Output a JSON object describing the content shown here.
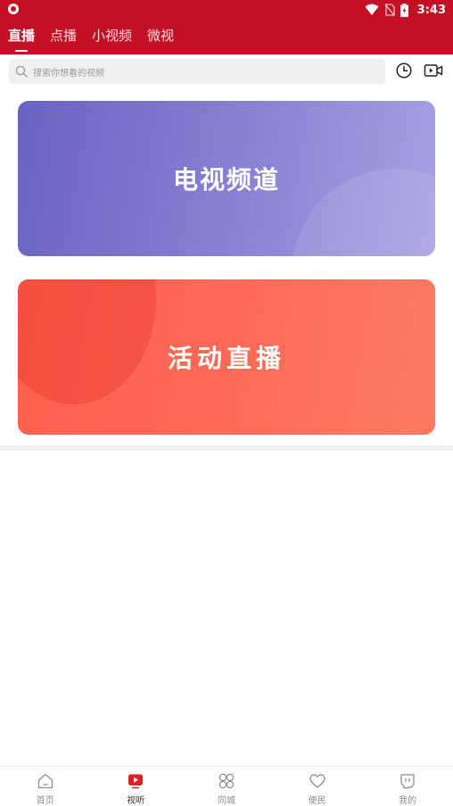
{
  "status_bar": {
    "time": "3:43",
    "icons": [
      "app-shield-icon",
      "wifi-icon",
      "no-sim-icon",
      "battery-charging-icon"
    ]
  },
  "tabs": [
    {
      "label": "直播",
      "active": true
    },
    {
      "label": "点播",
      "active": false
    },
    {
      "label": "小视频",
      "active": false
    },
    {
      "label": "微视",
      "active": false
    }
  ],
  "search": {
    "placeholder": "搜索你想看的视频",
    "icon": "search-icon"
  },
  "actions": {
    "history_icon": "clock-icon",
    "video_icon": "video-camera-icon"
  },
  "cards": [
    {
      "title": "电视频道",
      "color": "#7a72cc"
    },
    {
      "title": "活动直播",
      "color": "#ff6652"
    }
  ],
  "bottom_nav": [
    {
      "label": "首页",
      "icon": "home-icon",
      "active": false
    },
    {
      "label": "视听",
      "icon": "play-icon",
      "active": true
    },
    {
      "label": "同城",
      "icon": "grid-circles-icon",
      "active": false
    },
    {
      "label": "便民",
      "icon": "heart-icon",
      "active": false
    },
    {
      "label": "我的",
      "icon": "user-icon",
      "active": false
    }
  ],
  "colors": {
    "brand": "#c50f24",
    "active_nav": "#e02020"
  }
}
